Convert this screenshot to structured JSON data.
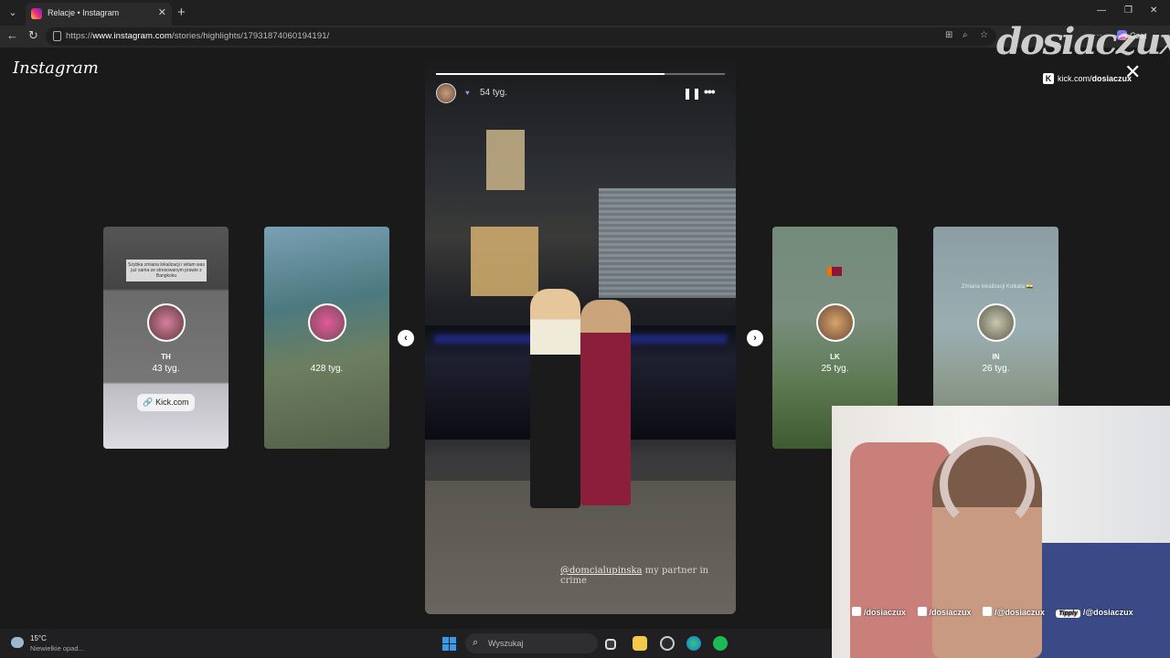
{
  "browser": {
    "tab_title": "Relacje • Instagram",
    "url_prefix": "https://",
    "url_host": "www.instagram.com",
    "url_path": "/stories/highlights/17931874060194191/",
    "copilot_label": "Czat"
  },
  "instagram": {
    "logo": "Instagram",
    "story": {
      "time": "54 tyg.",
      "progress": 0.79,
      "caption_mention": "@domcialupinska",
      "caption_text": " my partner in crime"
    },
    "side_stories": [
      {
        "name": "TH",
        "time": "43 tyg.",
        "banner_text": "Szybka zmiana lokalizacji i witam was już sama ze stresowanym prawie z Bangkoku",
        "link_label": "Kick.com"
      },
      {
        "name": "",
        "time": "428 tyg."
      },
      {
        "name": "LK",
        "time": "25 tyg."
      },
      {
        "name": "IN",
        "time": "26 tyg.",
        "overlay_text": "Zmiana lokalizacji Kolkata 🇮🇳"
      }
    ]
  },
  "overlay": {
    "watermark": "dosiaczux",
    "kick_prefix": "kick.com/",
    "kick_user": "dosiaczux",
    "socials": {
      "instagram": "/dosiaczux",
      "tiktok": "/dosiaczux",
      "youtube": "/@dosiaczux",
      "tipply_badge": "Tipply",
      "tipply": "/@dosiaczux"
    }
  },
  "taskbar": {
    "temperature": "15°C",
    "weather": "Niewielkie opad...",
    "search_placeholder": "Wyszukaj"
  },
  "icons": [
    "menu-icon",
    "instagram-favicon",
    "close-tab-icon",
    "new-tab-icon",
    "back-icon",
    "reload-icon",
    "lock-icon",
    "star-icon",
    "pause-icon",
    "more-icon",
    "close-icon",
    "chevron-left-icon",
    "chevron-right-icon",
    "windows-icon",
    "search-icon"
  ]
}
